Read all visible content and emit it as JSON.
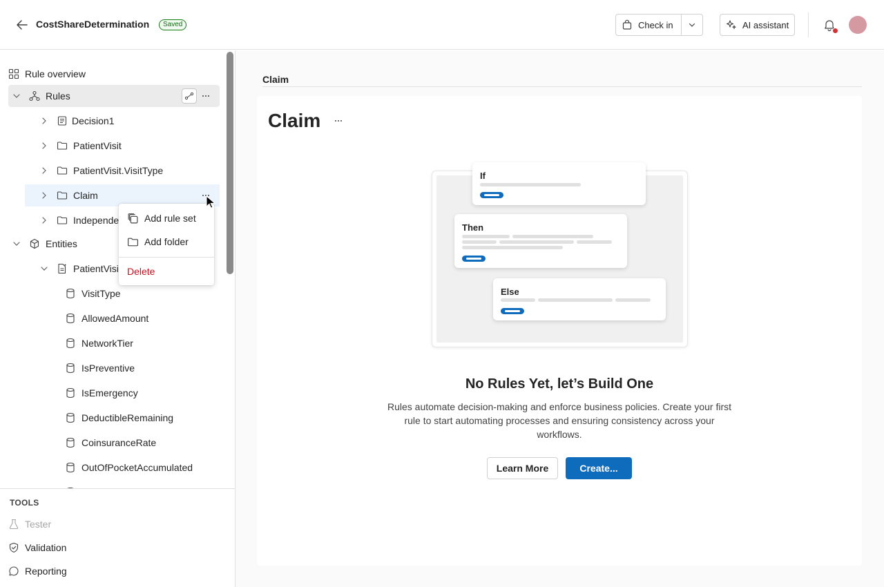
{
  "header": {
    "title": "CostShareDetermination",
    "status_badge": "Saved",
    "checkin_label": "Check in",
    "ai_assistant_label": "AI assistant"
  },
  "sidebar": {
    "rule_overview": "Rule overview",
    "rules_label": "Rules",
    "rule_items": [
      {
        "label": "Decision1",
        "icon": "decision-icon"
      },
      {
        "label": "PatientVisit",
        "icon": "folder-icon"
      },
      {
        "label": "PatientVisit.VisitType",
        "icon": "folder-icon"
      },
      {
        "label": "Claim",
        "icon": "folder-icon"
      },
      {
        "label": "Independe",
        "icon": "folder-icon"
      }
    ],
    "entities_label": "Entities",
    "entity_label": "PatientVisit",
    "fields": [
      "VisitType",
      "AllowedAmount",
      "NetworkTier",
      "IsPreventive",
      "IsEmergency",
      "DeductibleRemaining",
      "CoinsuranceRate",
      "OutOfPocketAccumulated"
    ],
    "tools_title": "TOOLS",
    "tools": [
      {
        "label": "Tester",
        "icon": "flask-icon",
        "disabled": true
      },
      {
        "label": "Validation",
        "icon": "shield-check-icon",
        "disabled": false
      },
      {
        "label": "Reporting",
        "icon": "chat-icon",
        "disabled": false
      }
    ]
  },
  "context_menu": {
    "add_rule_set": "Add rule set",
    "add_folder": "Add folder",
    "delete": "Delete"
  },
  "main": {
    "breadcrumb": "Claim",
    "title": "Claim",
    "illustration": {
      "if": "If",
      "then": "Then",
      "else": "Else"
    },
    "empty_title": "No Rules Yet, let’s Build One",
    "empty_desc": "Rules automate decision-making and enforce business policies. Create your first rule to start automating processes and ensuring consistency across your workflows.",
    "learn_more": "Learn More",
    "create": "Create..."
  },
  "colors": {
    "accent": "#0f6cbd",
    "danger": "#c50f1f",
    "saved_green": "#107c10",
    "selected_row": "#ebf3fc",
    "notification_dot": "#d13438"
  }
}
